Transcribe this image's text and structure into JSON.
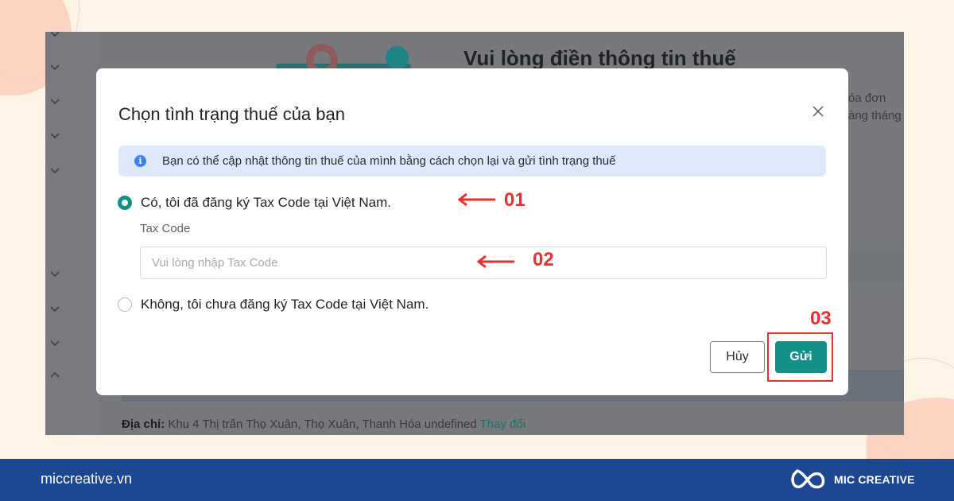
{
  "background_page": {
    "title": "Vui lòng điền thông tin thuế",
    "side_text": [
      "óa đơn",
      "àng tháng"
    ],
    "address_label": "Địa chỉ:",
    "address_value": "Khu 4 Thị trấn Thọ Xuân, Thọ Xuân, Thanh Hóa undefined",
    "address_change_link": "Thay đổi",
    "sidebar_chevrons": [
      "chevron-down",
      "chevron-down",
      "chevron-down",
      "chevron-down",
      "chevron-down",
      "chevron-down",
      "chevron-down",
      "chevron-down",
      "chevron-up"
    ]
  },
  "modal": {
    "title": "Chọn tình trạng thuế của bạn",
    "close_icon": "close-icon",
    "info": {
      "icon": "info-icon",
      "text": "Bạn có thể cập nhật thông tin thuế của mình bằng cách chọn lại và gửi tình trạng thuế"
    },
    "options": [
      {
        "label": "Có, tôi đã đăng ký Tax Code tại Việt Nam.",
        "checked": true
      },
      {
        "label": "Không, tôi chưa đăng ký Tax Code tại Việt Nam.",
        "checked": false
      }
    ],
    "tax_code": {
      "label": "Tax Code",
      "value": "",
      "placeholder": "Vui lòng nhập Tax Code"
    },
    "buttons": {
      "cancel": "Hủy",
      "submit": "Gửi"
    },
    "accent_color": "#139088"
  },
  "annotations": {
    "step1": "01",
    "step2": "02",
    "step3": "03",
    "color": "#e8302f"
  },
  "footer": {
    "site": "miccreative.vn",
    "brand": "MIC CREATIVE"
  }
}
